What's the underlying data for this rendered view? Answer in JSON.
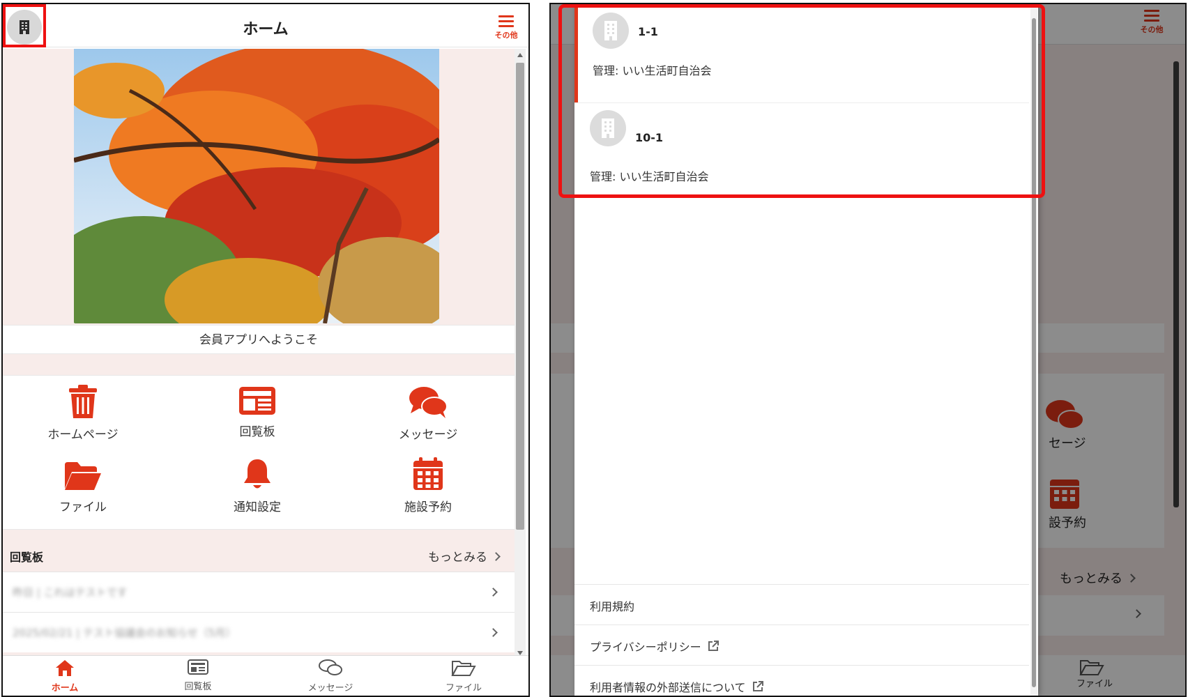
{
  "left": {
    "header": {
      "title": "ホーム",
      "menu_label": "その他"
    },
    "welcome": "会員アプリへようこそ",
    "menu_tiles": [
      {
        "label": "ホームページ",
        "icon": "trash-icon"
      },
      {
        "label": "回覧板",
        "icon": "newspaper-icon"
      },
      {
        "label": "メッセージ",
        "icon": "chat-bubbles-icon"
      },
      {
        "label": "ファイル",
        "icon": "folder-open-icon"
      },
      {
        "label": "通知設定",
        "icon": "bell-icon"
      },
      {
        "label": "施設予約",
        "icon": "calendar-icon"
      }
    ],
    "circular": {
      "title": "回覧板",
      "more": "もっとみる",
      "items": [
        "昨日 | これはテストです",
        "2025/02/21 | テスト協議会のお知らせ（5月）"
      ]
    },
    "tabs": [
      {
        "label": "ホーム",
        "icon": "home-icon"
      },
      {
        "label": "回覧板",
        "icon": "newspaper-icon"
      },
      {
        "label": "メッセージ",
        "icon": "chat-bubbles-icon"
      },
      {
        "label": "ファイル",
        "icon": "folder-open-icon"
      }
    ],
    "accent": "#e0361a"
  },
  "right": {
    "background": {
      "menu_label": "その他",
      "message_partial": "セージ",
      "reserve_partial": "設予約",
      "more": "もっとみる",
      "file_partial": "ファイル"
    },
    "drawer": {
      "organizations": [
        {
          "name": "1-1",
          "admin": "管理: いい生活町自治会",
          "active": true
        },
        {
          "name": "10-1",
          "admin": "管理: いい生活町自治会",
          "active": false
        }
      ],
      "links": [
        {
          "label": "利用規約",
          "external": false
        },
        {
          "label": "プライバシーポリシー",
          "external": true
        },
        {
          "label": "利用者情報の外部送信について",
          "external": true
        }
      ]
    },
    "highlight_color": "#ee1111"
  }
}
